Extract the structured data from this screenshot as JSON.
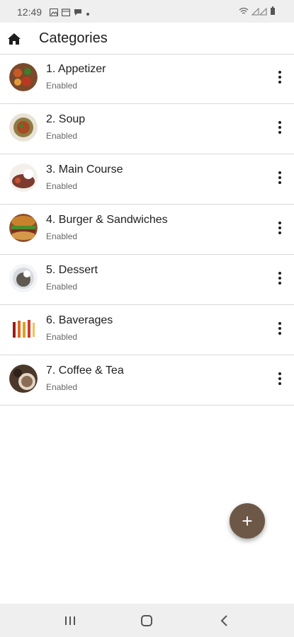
{
  "status_bar": {
    "time": "12:49",
    "left_icons": [
      "image-icon",
      "calendar-icon",
      "message-icon",
      "dot-icon"
    ],
    "right_icons": [
      "wifi-icon",
      "signal-icon",
      "battery-icon"
    ]
  },
  "app_bar": {
    "icon": "home-icon",
    "title": "Categories"
  },
  "categories": [
    {
      "title": "1. Appetizer",
      "status": "Enabled",
      "thumb_color": "#7a4a2b"
    },
    {
      "title": "2. Soup",
      "status": "Enabled",
      "thumb_color": "#8f7c45"
    },
    {
      "title": "3. Main Course",
      "status": "Enabled",
      "thumb_color": "#7d3b2f"
    },
    {
      "title": "4. Burger & Sandwiches",
      "status": "Enabled",
      "thumb_color": "#8b4f2b"
    },
    {
      "title": "5. Dessert",
      "status": "Enabled",
      "thumb_color": "#5f5951"
    },
    {
      "title": "6. Baverages",
      "status": "Enabled",
      "thumb_color": "#d9c9b9"
    },
    {
      "title": "7. Coffee & Tea",
      "status": "Enabled",
      "thumb_color": "#4b382b"
    }
  ],
  "fab": {
    "label": "+",
    "color": "#6d5847"
  },
  "nav_bar": {
    "icons": [
      "recent-apps-icon",
      "home-icon",
      "back-icon"
    ]
  }
}
